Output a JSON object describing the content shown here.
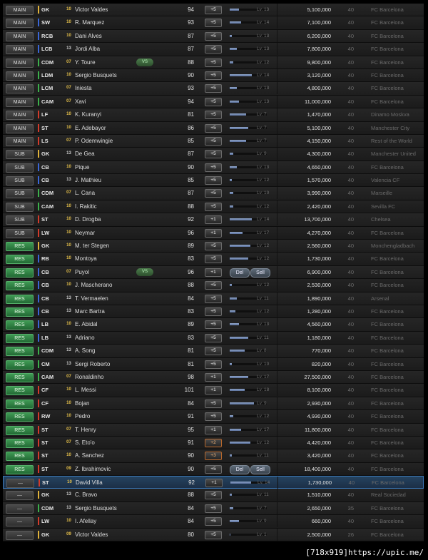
{
  "colors": {
    "gk": "#e0b23a",
    "def": "#3a66d6",
    "mid": "#3bb04a",
    "att": "#d23a2a"
  },
  "players": [
    {
      "role": "MAIN",
      "role_style": "main",
      "pos": "GK",
      "lvl": "10",
      "name": "Victor Valdes",
      "rating": "94",
      "bonus": "+5",
      "xp": 0.25,
      "lv": "Lv. 13",
      "value": "5,100,000",
      "contract": "40",
      "club": "FC Barcelona"
    },
    {
      "role": "MAIN",
      "role_style": "main",
      "pos": "SW",
      "lvl": "10",
      "name": "R. Marquez",
      "rating": "93",
      "bonus": "+5",
      "xp": 0.3,
      "lv": "Lv. 14",
      "value": "7,100,000",
      "contract": "40",
      "club": "FC Barcelona"
    },
    {
      "role": "MAIN",
      "role_style": "main",
      "pos": "RCB",
      "lvl": "10",
      "name": "Dani Alves",
      "rating": "87",
      "bonus": "+5",
      "xp": 0.05,
      "lv": "Lv. 13",
      "value": "6,200,000",
      "contract": "40",
      "club": "FC Barcelona"
    },
    {
      "role": "MAIN",
      "role_style": "main",
      "pos": "LCB",
      "lvl": "13",
      "name": "Jordi Alba",
      "rating": "87",
      "bonus": "+5",
      "xp": 0.2,
      "lv": "Lv. 13",
      "value": "7,800,000",
      "contract": "40",
      "club": "FC Barcelona"
    },
    {
      "role": "MAIN",
      "role_style": "main",
      "pos": "CDM",
      "lvl": "07",
      "name": "Y. Toure",
      "chem": "VS",
      "rating": "88",
      "bonus": "+5",
      "xp": 0.1,
      "lv": "Lv. 12",
      "value": "9,800,000",
      "contract": "40",
      "club": "FC Barcelona"
    },
    {
      "role": "MAIN",
      "role_style": "main",
      "pos": "LDM",
      "lvl": "10",
      "name": "Sergio Busquets",
      "rating": "90",
      "bonus": "+5",
      "xp": 0.6,
      "lv": "Lv. 14",
      "value": "3,120,000",
      "contract": "40",
      "club": "FC Barcelona"
    },
    {
      "role": "MAIN",
      "role_style": "main",
      "pos": "LCM",
      "lvl": "07",
      "name": "Iniesta",
      "rating": "93",
      "bonus": "+5",
      "xp": 0.2,
      "lv": "Lv. 13",
      "value": "4,800,000",
      "contract": "40",
      "club": "FC Barcelona"
    },
    {
      "role": "MAIN",
      "role_style": "main",
      "pos": "CAM",
      "lvl": "07",
      "name": "Xavi",
      "rating": "94",
      "bonus": "+5",
      "xp": 0.25,
      "lv": "Lv. 13",
      "value": "11,000,000",
      "contract": "40",
      "club": "FC Barcelona"
    },
    {
      "role": "MAIN",
      "role_style": "main",
      "pos": "LF",
      "lvl": "10",
      "name": "K. Kuranyi",
      "rating": "81",
      "bonus": "+5",
      "xp": 0.45,
      "lv": "Lv. 7",
      "value": "1,470,000",
      "contract": "40",
      "club": "Dinamo Moskva"
    },
    {
      "role": "MAIN",
      "role_style": "main",
      "pos": "ST",
      "lvl": "10",
      "name": "E. Adebayor",
      "rating": "86",
      "bonus": "+5",
      "xp": 0.5,
      "lv": "Lv. 7",
      "value": "5,100,000",
      "contract": "40",
      "club": "Manchester City"
    },
    {
      "role": "MAIN",
      "role_style": "main",
      "pos": "LS",
      "lvl": "07",
      "name": "P. Odemwingie",
      "rating": "85",
      "bonus": "+5",
      "xp": 0.45,
      "lv": "Lv. 7",
      "value": "4,150,000",
      "contract": "40",
      "club": "Rest of the World"
    },
    {
      "role": "SUB",
      "role_style": "main",
      "pos": "GK",
      "lvl": "13",
      "name": "De Gea",
      "rating": "87",
      "bonus": "+5",
      "xp": 0.1,
      "lv": "Lv. 9",
      "value": "4,300,000",
      "contract": "40",
      "club": "Manchester United"
    },
    {
      "role": "SUB",
      "role_style": "main",
      "pos": "CB",
      "lvl": "10",
      "name": "Pique",
      "rating": "90",
      "bonus": "+5",
      "xp": 0.2,
      "lv": "Lv. 13",
      "value": "4,650,000",
      "contract": "40",
      "club": "FC Barcelona"
    },
    {
      "role": "SUB",
      "role_style": "main",
      "pos": "CB",
      "lvl": "13",
      "name": "J. Mathieu",
      "rating": "85",
      "bonus": "+5",
      "xp": 0.05,
      "lv": "Lv. 12",
      "value": "1,570,000",
      "contract": "40",
      "club": "Valencia CF"
    },
    {
      "role": "SUB",
      "role_style": "main",
      "pos": "CDM",
      "lvl": "07",
      "name": "L. Cana",
      "rating": "87",
      "bonus": "+5",
      "xp": 0.1,
      "lv": "Lv. 10",
      "value": "3,990,000",
      "contract": "40",
      "club": "Marseille"
    },
    {
      "role": "SUB",
      "role_style": "main",
      "pos": "CAM",
      "lvl": "10",
      "name": "I. Rakitic",
      "rating": "88",
      "bonus": "+5",
      "xp": 0.1,
      "lv": "Lv. 12",
      "value": "2,420,000",
      "contract": "40",
      "club": "Sevilla FC"
    },
    {
      "role": "SUB",
      "role_style": "main",
      "pos": "ST",
      "lvl": "10",
      "name": "D. Drogba",
      "rating": "92",
      "bonus": "+1",
      "xp": 0.6,
      "lv": "Lv. 14",
      "value": "13,700,000",
      "contract": "40",
      "club": "Chelsea"
    },
    {
      "role": "SUB",
      "role_style": "main",
      "pos": "LW",
      "lvl": "10",
      "name": "Neymar",
      "rating": "96",
      "bonus": "+1",
      "xp": 0.35,
      "lv": "Lv. 17",
      "value": "4,270,000",
      "contract": "40",
      "club": "FC Barcelona"
    },
    {
      "role": "RES",
      "role_style": "res",
      "pos": "GK",
      "lvl": "10",
      "name": "M. ter Stegen",
      "rating": "89",
      "bonus": "+5",
      "xp": 0.55,
      "lv": "Lv. 12",
      "value": "2,560,000",
      "contract": "40",
      "club": "Monchengladbach"
    },
    {
      "role": "RES",
      "role_style": "res",
      "pos": "RB",
      "lvl": "10",
      "name": "Montoya",
      "rating": "83",
      "bonus": "+5",
      "xp": 0.5,
      "lv": "Lv. 12",
      "value": "1,730,000",
      "contract": "40",
      "club": "FC Barcelona"
    },
    {
      "role": "RES",
      "role_style": "res",
      "pos": "CB",
      "lvl": "07",
      "name": "Puyol",
      "chem": "VS",
      "rating": "96",
      "bonus": "+1",
      "actions": true,
      "del": "Del",
      "sell": "Sell",
      "value": "6,900,000",
      "contract": "40",
      "club": "FC Barcelona"
    },
    {
      "role": "RES",
      "role_style": "res",
      "pos": "CB",
      "lvl": "10",
      "name": "J. Mascherano",
      "rating": "88",
      "bonus": "+5",
      "xp": 0.05,
      "lv": "Lv. 12",
      "value": "2,530,000",
      "contract": "40",
      "club": "FC Barcelona"
    },
    {
      "role": "RES",
      "role_style": "res",
      "pos": "CB",
      "lvl": "13",
      "name": "T. Vermaelen",
      "rating": "84",
      "bonus": "+5",
      "xp": 0.2,
      "lv": "Lv. 11",
      "value": "1,890,000",
      "contract": "40",
      "club": "Arsenal"
    },
    {
      "role": "RES",
      "role_style": "res",
      "pos": "CB",
      "lvl": "13",
      "name": "Marc Bartra",
      "rating": "83",
      "bonus": "+5",
      "xp": 0.15,
      "lv": "Lv. 12",
      "value": "1,280,000",
      "contract": "40",
      "club": "FC Barcelona"
    },
    {
      "role": "RES",
      "role_style": "res",
      "pos": "LB",
      "lvl": "10",
      "name": "E. Abidal",
      "rating": "89",
      "bonus": "+5",
      "xp": 0.25,
      "lv": "Lv. 13",
      "value": "4,560,000",
      "contract": "40",
      "club": "FC Barcelona"
    },
    {
      "role": "RES",
      "role_style": "res",
      "pos": "LB",
      "lvl": "13",
      "name": "Adriano",
      "rating": "83",
      "bonus": "+5",
      "xp": 0.5,
      "lv": "Lv. 11",
      "value": "1,180,000",
      "contract": "40",
      "club": "FC Barcelona"
    },
    {
      "role": "RES",
      "role_style": "res",
      "pos": "CDM",
      "lvl": "13",
      "name": "A. Song",
      "rating": "81",
      "bonus": "+5",
      "xp": 0.4,
      "lv": "Lv. 8",
      "value": "770,000",
      "contract": "40",
      "club": "FC Barcelona"
    },
    {
      "role": "RES",
      "role_style": "res",
      "pos": "CM",
      "lvl": "13",
      "name": "Sergi Roberto",
      "rating": "81",
      "bonus": "+5",
      "xp": 0.05,
      "lv": "Lv. 10",
      "value": "820,000",
      "contract": "40",
      "club": "FC Barcelona"
    },
    {
      "role": "RES",
      "role_style": "res",
      "pos": "CAM",
      "lvl": "07",
      "name": "Ronaldinho",
      "rating": "98",
      "bonus": "+1",
      "xp": 0.5,
      "lv": "Lv. 17",
      "value": "27,500,000",
      "contract": "40",
      "club": "FC Barcelona"
    },
    {
      "role": "RES",
      "role_style": "res",
      "pos": "CF",
      "lvl": "10",
      "name": "L. Messi",
      "rating": "101",
      "bonus": "+1",
      "xp": 0.4,
      "lv": "Lv. 18",
      "value": "8,100,000",
      "contract": "40",
      "club": "FC Barcelona"
    },
    {
      "role": "RES",
      "role_style": "res",
      "pos": "CF",
      "lvl": "10",
      "name": "Bojan",
      "rating": "84",
      "bonus": "+5",
      "xp": 0.65,
      "lv": "Lv. 9",
      "value": "2,930,000",
      "contract": "40",
      "club": "FC Barcelona"
    },
    {
      "role": "RES",
      "role_style": "res",
      "pos": "RW",
      "lvl": "10",
      "name": "Pedro",
      "rating": "91",
      "bonus": "+5",
      "xp": 0.1,
      "lv": "Lv. 12",
      "value": "4,930,000",
      "contract": "40",
      "club": "FC Barcelona"
    },
    {
      "role": "RES",
      "role_style": "res",
      "pos": "ST",
      "lvl": "07",
      "name": "T. Henry",
      "rating": "95",
      "bonus": "+1",
      "xp": 0.3,
      "lv": "Lv. 17",
      "value": "11,800,000",
      "contract": "40",
      "club": "FC Barcelona"
    },
    {
      "role": "RES",
      "role_style": "res",
      "pos": "ST",
      "lvl": "07",
      "name": "S. Eto'o",
      "rating": "91",
      "bonus": "+2",
      "bonus_style": "neg",
      "xp": 0.55,
      "lv": "Lv. 12",
      "value": "4,420,000",
      "contract": "40",
      "club": "FC Barcelona"
    },
    {
      "role": "RES",
      "role_style": "res",
      "pos": "ST",
      "lvl": "10",
      "name": "A. Sanchez",
      "rating": "90",
      "bonus": "+3",
      "bonus_style": "neg",
      "xp": 0.05,
      "lv": "Lv. 11",
      "value": "3,420,000",
      "contract": "40",
      "club": "FC Barcelona"
    },
    {
      "role": "RES",
      "role_style": "res",
      "pos": "ST",
      "lvl": "09",
      "name": "Z. Ibrahimovic",
      "rating": "90",
      "bonus": "+5",
      "actions": true,
      "del": "Del",
      "sell": "Sell",
      "value": "18,400,000",
      "contract": "40",
      "club": "FC Barcelona"
    },
    {
      "role": "—",
      "role_style": "none",
      "pos": "ST",
      "lvl": "10",
      "name": "David Villa",
      "rating": "92",
      "bonus": "+1",
      "xp": 0.55,
      "lv": "Lv. 14",
      "value": "1,730,000",
      "contract": "40",
      "club": "FC Barcelona",
      "highlight": true
    },
    {
      "role": "—",
      "role_style": "none",
      "pos": "GK",
      "lvl": "13",
      "name": "C. Bravo",
      "rating": "88",
      "bonus": "+5",
      "xp": 0.05,
      "lv": "Lv. 11",
      "value": "1,510,000",
      "contract": "40",
      "club": "Real Sociedad"
    },
    {
      "role": "—",
      "role_style": "none",
      "pos": "CDM",
      "lvl": "13",
      "name": "Sergio Busquets",
      "rating": "84",
      "bonus": "+5",
      "xp": 0.1,
      "lv": "Lv. 7",
      "value": "2,650,000",
      "contract": "35",
      "club": "FC Barcelona"
    },
    {
      "role": "—",
      "role_style": "none",
      "pos": "LW",
      "lvl": "10",
      "name": "I. Afellay",
      "rating": "84",
      "bonus": "+5",
      "xp": 0.25,
      "lv": "Lv. 9",
      "value": "660,000",
      "contract": "40",
      "club": "FC Barcelona"
    },
    {
      "role": "—",
      "role_style": "none",
      "pos": "GK",
      "lvl": "09",
      "name": "Victor Valdes",
      "rating": "80",
      "bonus": "+5",
      "xp": 0.02,
      "lv": "Lv. 1",
      "value": "2,500,000",
      "contract": "26",
      "club": "FC Barcelona"
    }
  ],
  "credit": "[718x919]https://upic.me/"
}
